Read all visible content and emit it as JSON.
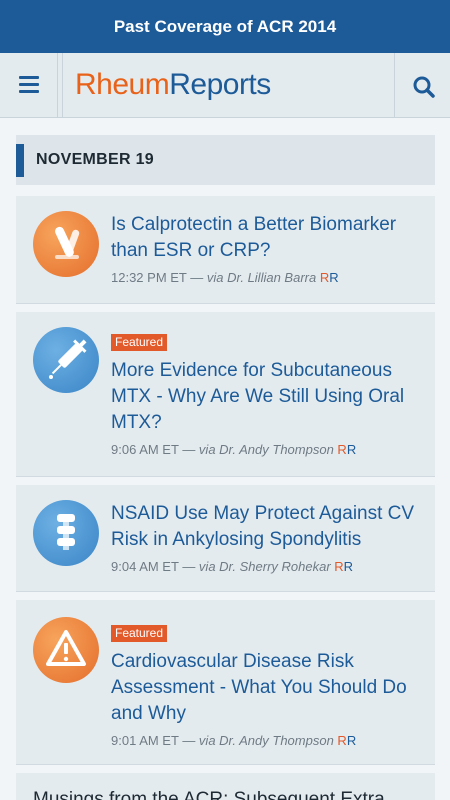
{
  "topbar": {
    "title": "Past Coverage of ACR 2014"
  },
  "header": {
    "logo_part1": "Rheum",
    "logo_part2": "Reports"
  },
  "section": {
    "date": "NOVEMBER 19"
  },
  "articles": [
    {
      "title": "Is Calprotectin a Better Biomarker than ESR or CRP?",
      "time": "12:32 PM ET",
      "via": "— via Dr. Lillian Barra",
      "featured": "",
      "icon": "test-tube-icon"
    },
    {
      "title": "More Evidence for Subcutaneous MTX - Why Are We Still Using Oral MTX?",
      "time": "9:06 AM ET",
      "via": "— via Dr. Andy Thompson",
      "featured": "Featured",
      "icon": "syringe-icon"
    },
    {
      "title": "NSAID Use May Protect Against CV Risk in Ankylosing Spondylitis",
      "time": "9:04 AM ET",
      "via": "— via Dr. Sherry Rohekar",
      "featured": "",
      "icon": "spine-icon"
    },
    {
      "title": "Cardiovascular Disease Risk Assessment - What You Should Do and Why",
      "time": "9:01 AM ET",
      "via": "— via Dr. Andy Thompson",
      "featured": "Featured",
      "icon": "warning-icon"
    }
  ],
  "rr_mark": {
    "r1": "R",
    "r2": "R"
  },
  "partial_item": {
    "title": "Musings from the ACR: Subsequent Extra..."
  },
  "colors": {
    "brand_blue": "#1d5b98",
    "brand_orange": "#e8621a",
    "featured_badge": "#e2592a"
  }
}
